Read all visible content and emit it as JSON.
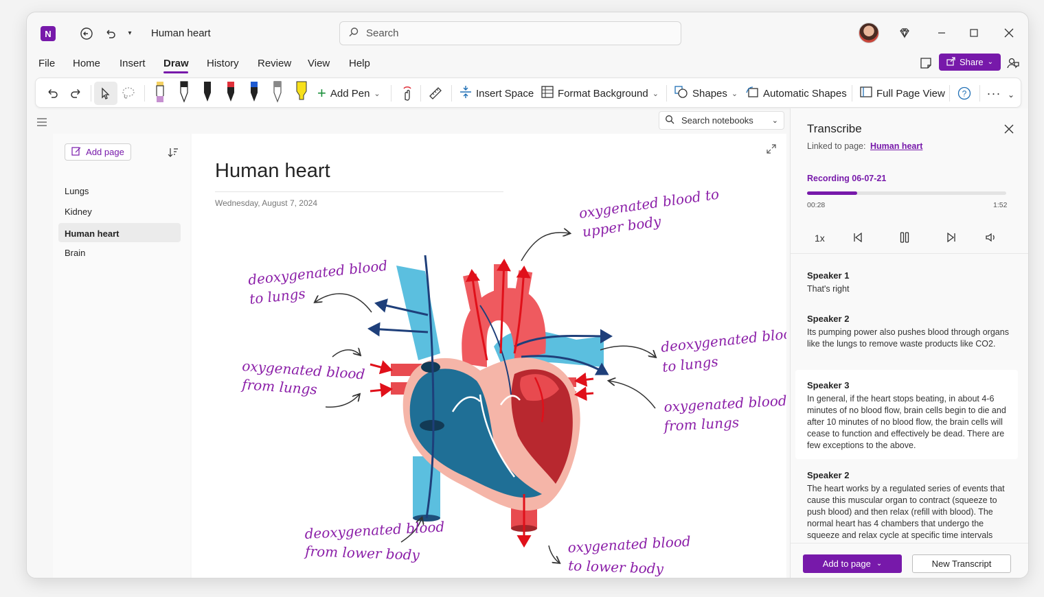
{
  "app": {
    "title": "Human heart",
    "search_placeholder": "Search"
  },
  "menu": [
    "File",
    "Home",
    "Insert",
    "Draw",
    "History",
    "Review",
    "View",
    "Help"
  ],
  "active_menu": "Draw",
  "header_actions": {
    "share_label": "Share"
  },
  "ribbon": {
    "add_pen": "Add Pen",
    "insert_space": "Insert Space",
    "format_background": "Format Background",
    "shapes": "Shapes",
    "automatic_shapes": "Automatic Shapes",
    "full_page_view": "Full Page View"
  },
  "notebook_search": {
    "placeholder": "Search notebooks"
  },
  "pages": {
    "add_page_label": "Add page",
    "items": [
      "Lungs",
      "Kidney",
      "Human heart",
      "Brain"
    ],
    "selected": "Human heart"
  },
  "page": {
    "title": "Human heart",
    "date": "Wednesday, August 7, 2024"
  },
  "annotations": {
    "upper_body": [
      "oxygenated blood to",
      "upper body"
    ],
    "deox_lungs_left": [
      "deoxygenated blood",
      "to lungs"
    ],
    "ox_from_lungs_left": [
      "oxygenated blood",
      "from lungs"
    ],
    "deox_lungs_right": [
      "deoxygenated blood",
      "to lungs"
    ],
    "ox_from_lungs_right": [
      "oxygenated blood",
      "from lungs"
    ],
    "deox_lower_body": [
      "deoxygenated blood",
      "from lower body"
    ],
    "ox_lower_body": [
      "oxygenated blood",
      "to lower body"
    ]
  },
  "transcribe": {
    "title": "Transcribe",
    "linked_prefix": "Linked to page:",
    "linked_page": "Human heart",
    "recording_name": "Recording 06-07-21",
    "current_time": "00:28",
    "total_time": "1:52",
    "progress": 0.25,
    "speed": "1x",
    "entries": [
      {
        "speaker": "Speaker 1",
        "text": "That's right"
      },
      {
        "speaker": "Speaker 2",
        "text": "Its pumping power also pushes blood through organs like the lungs to remove waste products like CO2."
      },
      {
        "speaker": "Speaker 3",
        "text": "In general, if the heart stops beating, in about 4-6 minutes of no blood flow, brain cells begin to die and after 10 minutes of no blood flow, the brain cells will cease to function and effectively be dead. There are few exceptions to the above."
      },
      {
        "speaker": "Speaker 2",
        "text": "The heart works by a regulated series of events that cause this muscular organ to contract (squeeze to push blood) and then relax (refill with blood). The normal heart has 4 chambers that undergo the squeeze and relax cycle at specific time intervals"
      }
    ],
    "add_to_page_label": "Add to page",
    "new_transcript_label": "New Transcript"
  },
  "colors": {
    "accent": "#7719aa",
    "handwriting": "#8b1fa8",
    "heart_red": "#e84a4f",
    "heart_blue": "#1f6f96",
    "vessel_light_blue": "#5bbfdf"
  }
}
